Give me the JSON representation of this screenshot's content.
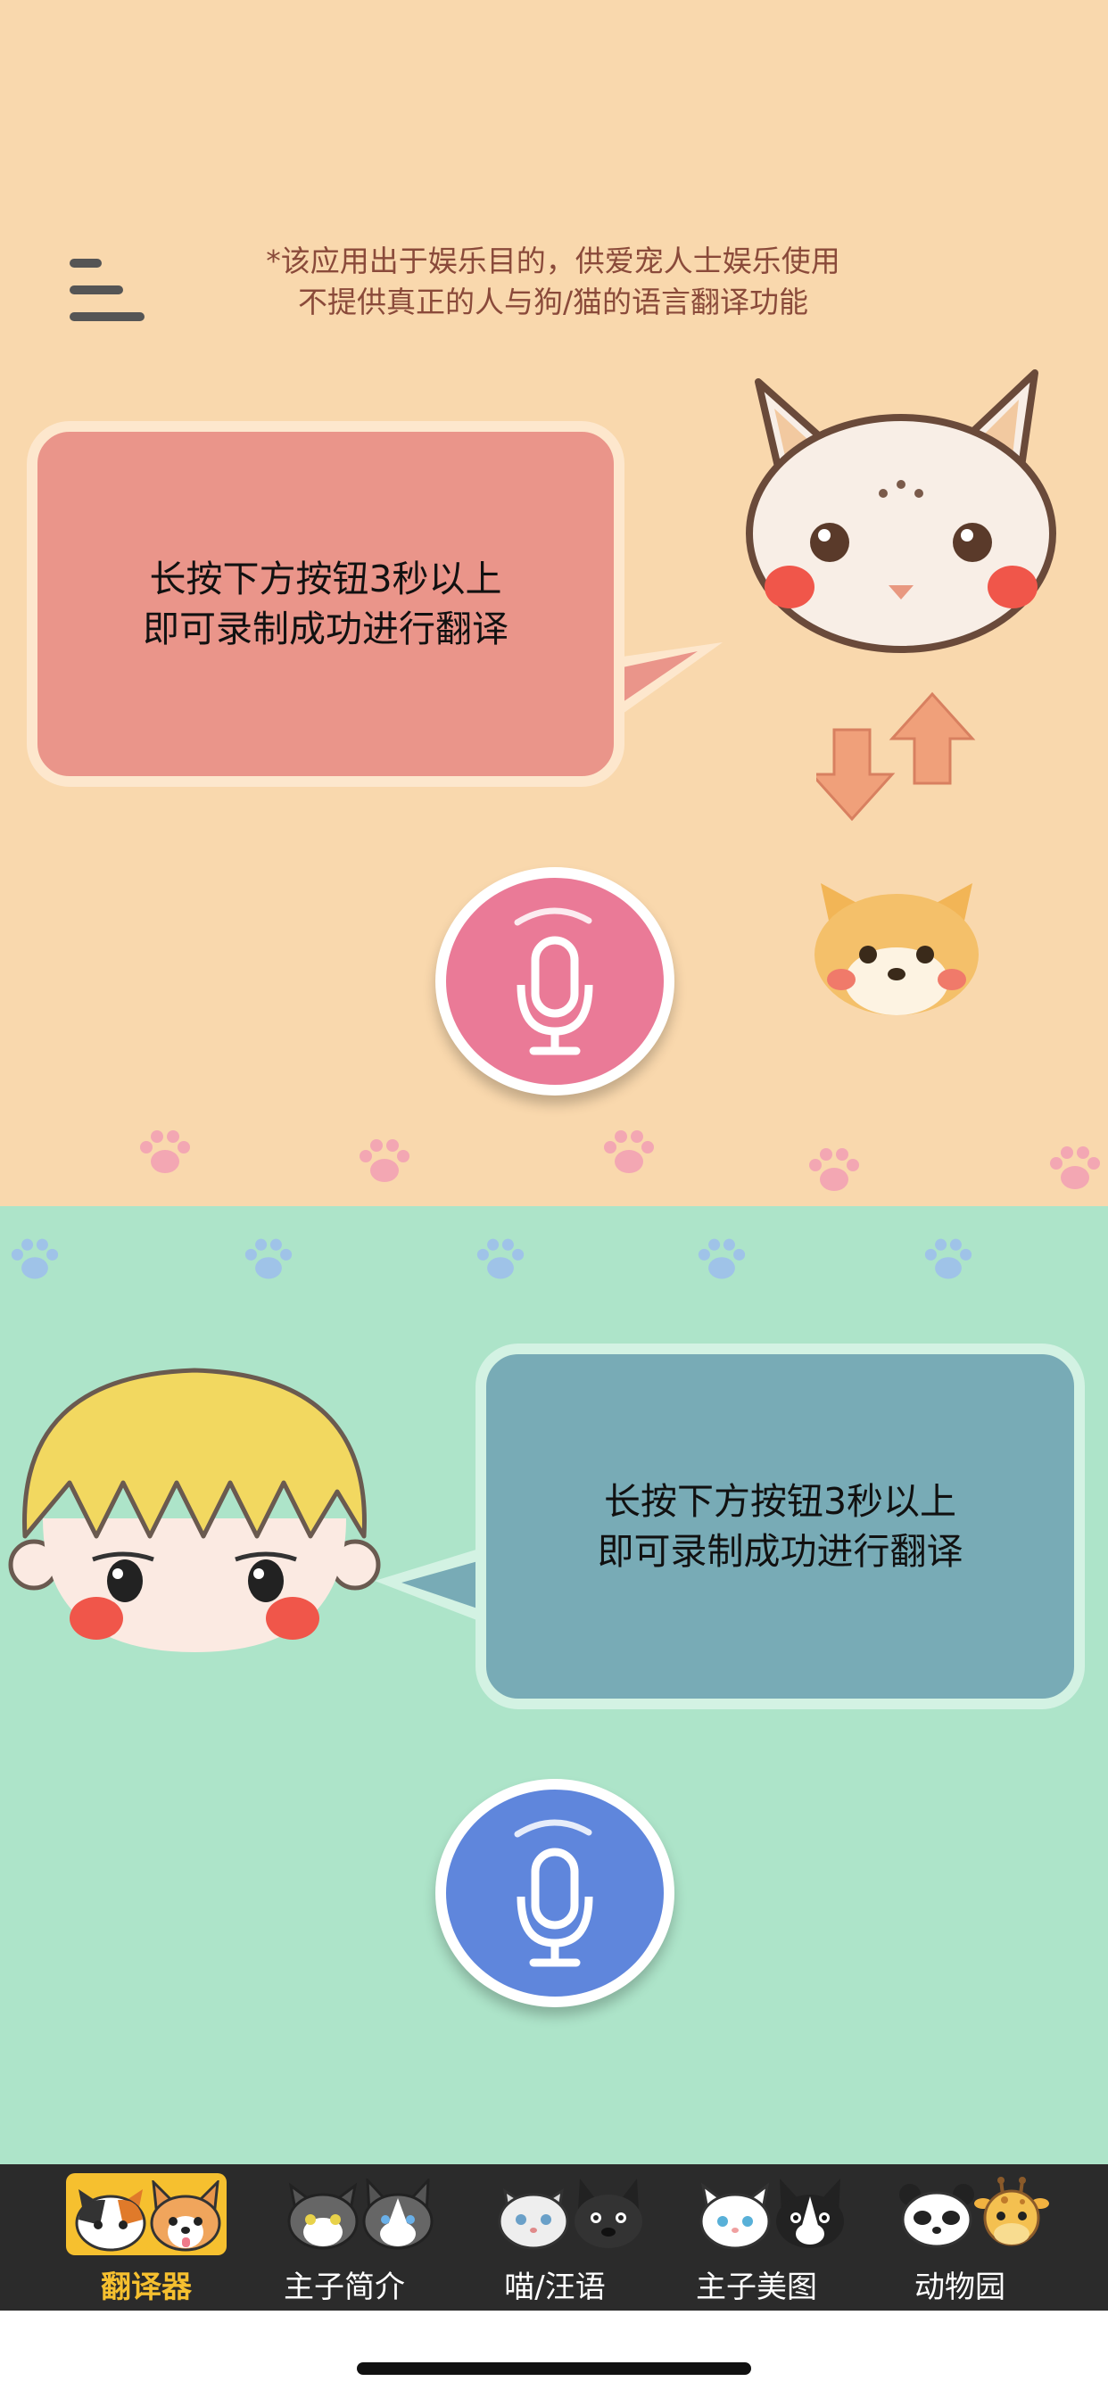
{
  "disclaimer": {
    "line1": "*该应用出于娱乐目的，供爱宠人士娱乐使用",
    "line2": "不提供真正的人与狗/猫的语言翻译功能"
  },
  "pet_panel": {
    "instruction_line1": "长按下方按钮3秒以上",
    "instruction_line2": "即可录制成功进行翻译",
    "bubble_color": "#ea958a",
    "background": "#f9d8ad",
    "mic_color": "#ea7a97"
  },
  "human_panel": {
    "instruction_line1": "长按下方按钮3秒以上",
    "instruction_line2": "即可录制成功进行翻译",
    "bubble_color": "#78abb6",
    "background": "#ade4c9",
    "mic_color": "#5f86dc"
  },
  "tabs": [
    {
      "label": "翻译器",
      "active": true,
      "icons": [
        "calico-cat-icon",
        "corgi-icon"
      ]
    },
    {
      "label": "主子简介",
      "active": false,
      "icons": [
        "tabby-cat-icon",
        "husky-icon"
      ]
    },
    {
      "label": "喵/汪语",
      "active": false,
      "icons": [
        "persian-cat-icon",
        "scottie-dog-icon"
      ]
    },
    {
      "label": "主子美图",
      "active": false,
      "icons": [
        "white-cat-icon",
        "boston-terrier-icon"
      ]
    },
    {
      "label": "动物园",
      "active": false,
      "icons": [
        "panda-icon",
        "giraffe-icon"
      ]
    }
  ],
  "accent_color": "#f6c02f"
}
